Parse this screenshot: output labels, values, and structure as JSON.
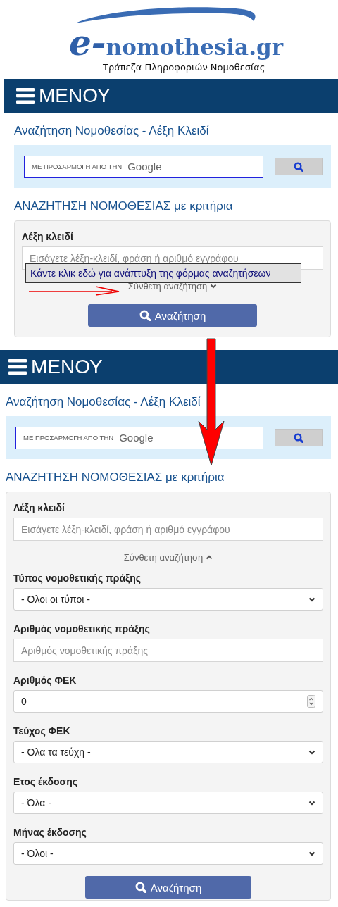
{
  "logo": {
    "prefix": "e-",
    "name": "nomothesia.gr",
    "tagline": "Τράπεζα Πληροφοριών Νομοθεσίας"
  },
  "panels": [
    {
      "menu": {
        "label": "ΜΕΝΟΥ"
      },
      "keyword_title": "Αναζήτηση Νομοθεσίας - Λέξη Κλειδί",
      "google_search": {
        "prefix": "ΜΕ ΠΡΟΣΑΡΜΟΓΗ ΑΠΟ ΤΗΝ",
        "brand": "Google"
      },
      "criteria_title": "ΑΝΑΖΗΤΗΣΗ ΝΟΜΟΘΕΣΙΑΣ με κριτήρια",
      "form": {
        "keyword": {
          "label": "Λέξη κλειδί",
          "placeholder": "Εισάγετε λέξη-κλειδί, φράση ή αριθμό εγγράφου"
        },
        "advanced_toggle": {
          "label": "Σύνθετη αναζήτηση",
          "expanded": false
        },
        "search_button": "Αναζήτηση"
      },
      "tooltip": "Κάντε κλικ εδώ για ανάπτυξη της φόρμας αναζητήσεων"
    },
    {
      "menu": {
        "label": "ΜΕΝΟΥ"
      },
      "keyword_title": "Αναζήτηση Νομοθεσίας - Λέξη Κλειδί",
      "google_search": {
        "prefix": "ΜΕ ΠΡΟΣΑΡΜΟΓΗ ΑΠΟ ΤΗΝ",
        "brand": "Google"
      },
      "criteria_title": "ΑΝΑΖΗΤΗΣΗ ΝΟΜΟΘΕΣΙΑΣ με κριτήρια",
      "form": {
        "keyword": {
          "label": "Λέξη κλειδί",
          "placeholder": "Εισάγετε λέξη-κλειδί, φράση ή αριθμό εγγράφου"
        },
        "advanced_toggle": {
          "label": "Σύνθετη αναζήτηση",
          "expanded": true
        },
        "fields": [
          {
            "kind": "select",
            "label": "Τύπος νομοθετικής πράξης",
            "value": "- Όλοι οι τύποι -"
          },
          {
            "kind": "text",
            "label": "Αριθμός νομοθετικής πράξης",
            "placeholder": "Αριθμός νομοθετικής πράξης"
          },
          {
            "kind": "number",
            "label": "Αριθμός ΦΕΚ",
            "value": "0"
          },
          {
            "kind": "select",
            "label": "Τεύχος ΦΕΚ",
            "value": "- Όλα τα τεύχη -"
          },
          {
            "kind": "select",
            "label": "Ετος έκδοσης",
            "value": "- Όλα -"
          },
          {
            "kind": "select",
            "label": "Μήνας έκδοσης",
            "value": "- Όλοι -"
          }
        ],
        "search_button": "Αναζήτηση"
      }
    }
  ]
}
